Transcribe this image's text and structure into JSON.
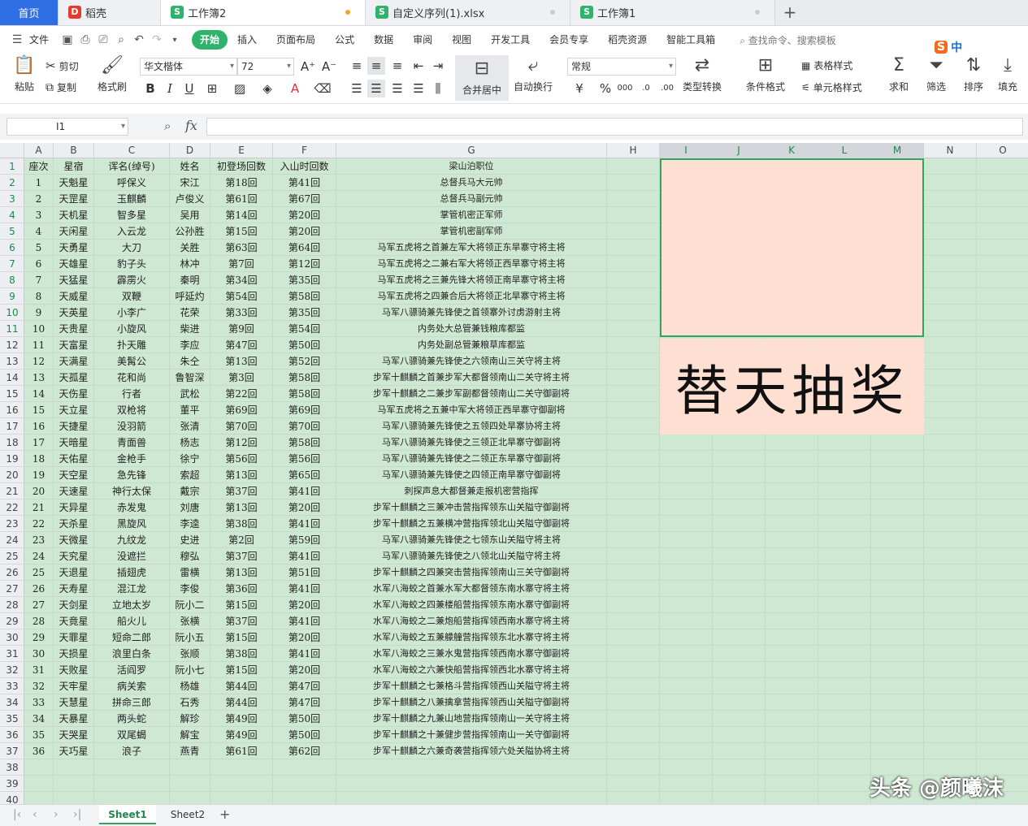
{
  "tabs": [
    {
      "label": "首页"
    },
    {
      "label": "稻壳"
    },
    {
      "label": "工作簿2"
    },
    {
      "label": "自定义序列(1).xlsx"
    },
    {
      "label": "工作簿1"
    }
  ],
  "menu": {
    "file": "文件",
    "items": [
      "开始",
      "插入",
      "页面布局",
      "公式",
      "数据",
      "审阅",
      "视图",
      "开发工具",
      "会员专享",
      "稻壳资源",
      "智能工具箱"
    ],
    "search_hint": "查找命令、搜索模板"
  },
  "ribbon": {
    "paste": "粘贴",
    "cut": "剪切",
    "copy": "复制",
    "format_painter": "格式刷",
    "font_name": "华文楷体",
    "font_size": "72",
    "merge_center": "合并居中",
    "auto_wrap": "自动换行",
    "number_format": "常规",
    "type_convert": "类型转换",
    "cond_format": "条件格式",
    "table_style": "表格样式",
    "cell_style": "单元格样式",
    "sum": "求和",
    "filter": "筛选",
    "sort": "排序",
    "fill": "填充",
    "ime_cn": "中"
  },
  "formula_bar": {
    "cell_ref": "I1",
    "fx": "fx",
    "value": ""
  },
  "columns": [
    "A",
    "B",
    "C",
    "D",
    "E",
    "F",
    "G",
    "H",
    "I",
    "J",
    "K",
    "L",
    "M",
    "N",
    "O"
  ],
  "header_row": [
    "座次",
    "星宿",
    "诨名(绰号)",
    "姓名",
    "初登场回数",
    "入山时回数",
    "梁山泊职位"
  ],
  "rows": [
    [
      "1",
      "天魁星",
      "呼保义",
      "宋江",
      "第18回",
      "第41回",
      "总督兵马大元帅"
    ],
    [
      "2",
      "天罡星",
      "玉麒麟",
      "卢俊义",
      "第61回",
      "第67回",
      "总督兵马副元帅"
    ],
    [
      "3",
      "天机星",
      "智多星",
      "吴用",
      "第14回",
      "第20回",
      "掌管机密正军师"
    ],
    [
      "4",
      "天闲星",
      "入云龙",
      "公孙胜",
      "第15回",
      "第20回",
      "掌管机密副军师"
    ],
    [
      "5",
      "天勇星",
      "大刀",
      "关胜",
      "第63回",
      "第64回",
      "马军五虎将之首兼左军大将领正东旱寨守将主将"
    ],
    [
      "6",
      "天雄星",
      "豹子头",
      "林冲",
      "第7回",
      "第12回",
      "马军五虎将之二兼右军大将领正西旱寨守将主将"
    ],
    [
      "7",
      "天猛星",
      "霹雳火",
      "秦明",
      "第34回",
      "第35回",
      "马军五虎将之三兼先锋大将领正南旱寨守将主将"
    ],
    [
      "8",
      "天威星",
      "双鞭",
      "呼延灼",
      "第54回",
      "第58回",
      "马军五虎将之四兼合后大将领正北旱寨守将主将"
    ],
    [
      "9",
      "天英星",
      "小李广",
      "花荣",
      "第33回",
      "第35回",
      "马军八骠骑兼先锋使之首领寨外讨虏游射主将"
    ],
    [
      "10",
      "天贵星",
      "小旋风",
      "柴进",
      "第9回",
      "第54回",
      "内务处大总管兼钱粮库都监"
    ],
    [
      "11",
      "天富星",
      "扑天雕",
      "李应",
      "第47回",
      "第50回",
      "内务处副总管兼粮草库都监"
    ],
    [
      "12",
      "天满星",
      "美髯公",
      "朱仝",
      "第13回",
      "第52回",
      "马军八骠骑兼先锋使之六领南山三关守将主将"
    ],
    [
      "13",
      "天孤星",
      "花和尚",
      "鲁智深",
      "第3回",
      "第58回",
      "步军十麒麟之首兼步军大都督领南山二关守将主将"
    ],
    [
      "14",
      "天伤星",
      "行者",
      "武松",
      "第22回",
      "第58回",
      "步军十麒麟之二兼步军副都督领南山二关守御副将"
    ],
    [
      "15",
      "天立星",
      "双枪将",
      "董平",
      "第69回",
      "第69回",
      "马军五虎将之五兼中军大将领正西旱寨守御副将"
    ],
    [
      "16",
      "天捷星",
      "没羽箭",
      "张清",
      "第70回",
      "第70回",
      "马军八骠骑兼先锋使之五领四处旱寨协将主将"
    ],
    [
      "17",
      "天暗星",
      "青面兽",
      "杨志",
      "第12回",
      "第58回",
      "马军八骠骑兼先锋使之三领正北旱寨守御副将"
    ],
    [
      "18",
      "天佑星",
      "金枪手",
      "徐宁",
      "第56回",
      "第56回",
      "马军八骠骑兼先锋使之二领正东旱寨守御副将"
    ],
    [
      "19",
      "天空星",
      "急先锋",
      "索超",
      "第13回",
      "第65回",
      "马军八骠骑兼先锋使之四领正南旱寨守御副将"
    ],
    [
      "20",
      "天速星",
      "神行太保",
      "戴宗",
      "第37回",
      "第41回",
      "刺探声息大都督兼走报机密营指挥"
    ],
    [
      "21",
      "天异星",
      "赤发鬼",
      "刘唐",
      "第13回",
      "第20回",
      "步军十麒麟之三兼冲击营指挥领东山关隘守御副将"
    ],
    [
      "22",
      "天杀星",
      "黑旋风",
      "李逵",
      "第38回",
      "第41回",
      "步军十麒麟之五兼横冲营指挥领北山关隘守御副将"
    ],
    [
      "23",
      "天微星",
      "九纹龙",
      "史进",
      "第2回",
      "第59回",
      "马军八骠骑兼先锋使之七领东山关隘守将主将"
    ],
    [
      "24",
      "天究星",
      "没遮拦",
      "穆弘",
      "第37回",
      "第41回",
      "马军八骠骑兼先锋使之八领北山关隘守将主将"
    ],
    [
      "25",
      "天退星",
      "插翅虎",
      "雷横",
      "第13回",
      "第51回",
      "步军十麒麟之四兼突击营指挥领南山三关守御副将"
    ],
    [
      "26",
      "天寿星",
      "混江龙",
      "李俊",
      "第36回",
      "第41回",
      "水军八海蛟之首兼水军大都督领东南水寨守将主将"
    ],
    [
      "27",
      "天剑星",
      "立地太岁",
      "阮小二",
      "第15回",
      "第20回",
      "水军八海蛟之四兼楼船营指挥领东南水寨守御副将"
    ],
    [
      "28",
      "天竟星",
      "船火儿",
      "张横",
      "第37回",
      "第41回",
      "水军八海蛟之二兼炮船营指挥领西南水寨守将主将"
    ],
    [
      "29",
      "天罪星",
      "短命二郎",
      "阮小五",
      "第15回",
      "第20回",
      "水军八海蛟之五兼艨艟营指挥领东北水寨守将主将"
    ],
    [
      "30",
      "天损星",
      "浪里白条",
      "张顺",
      "第38回",
      "第41回",
      "水军八海蛟之三兼水鬼营指挥领西南水寨守御副将"
    ],
    [
      "31",
      "天败星",
      "活阎罗",
      "阮小七",
      "第15回",
      "第20回",
      "水军八海蛟之六兼快船营指挥领西北水寨守将主将"
    ],
    [
      "32",
      "天牢星",
      "病关索",
      "杨雄",
      "第44回",
      "第47回",
      "步军十麒麟之七兼格斗营指挥领西山关隘守将主将"
    ],
    [
      "33",
      "天慧星",
      "拼命三郎",
      "石秀",
      "第44回",
      "第47回",
      "步军十麒麟之八兼擒拿营指挥领西山关隘守御副将"
    ],
    [
      "34",
      "天暴星",
      "两头蛇",
      "解珍",
      "第49回",
      "第50回",
      "步军十麒麟之九兼山地营指挥领南山一关守将主将"
    ],
    [
      "35",
      "天哭星",
      "双尾蝎",
      "解宝",
      "第49回",
      "第50回",
      "步军十麒麟之十兼健步营指挥领南山一关守御副将"
    ],
    [
      "36",
      "天巧星",
      "浪子",
      "燕青",
      "第61回",
      "第62回",
      "步军十麒麟之六兼奇袭营指挥领六处关隘协将主将"
    ]
  ],
  "raffle_text": "替天抽奖",
  "sheets": [
    "Sheet1",
    "Sheet2"
  ],
  "watermark": "头条 @颜曦沫",
  "colors": {
    "accent": "#2fb36b",
    "cell_bg": "#cfe8d3",
    "raffle_bg": "#fde0d2",
    "home_tab": "#2f6ee5"
  }
}
